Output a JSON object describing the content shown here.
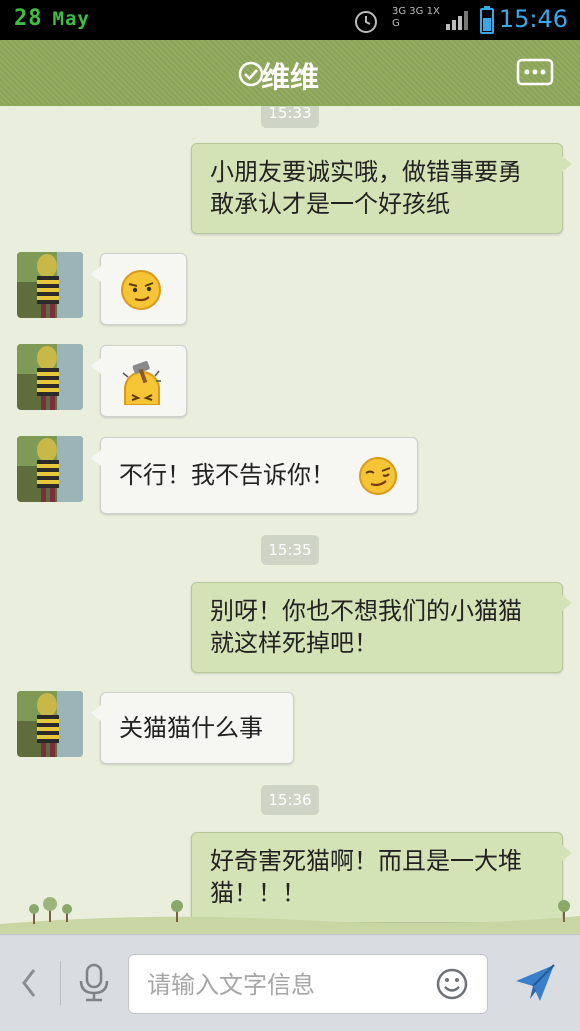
{
  "status_bar": {
    "day": "28",
    "month": "May",
    "network": "3G 3G 1X G",
    "time": "15:46"
  },
  "header": {
    "title": "维维"
  },
  "messages": {
    "top_timestamp": "15:33",
    "m1": "小朋友要诚实哦，做错事要勇敢承认才是一个好孩纸",
    "m2_emoji": "smirk-emoji",
    "m3_emoji": "hammer-head-emoji",
    "m4": "不行！我不告诉你！",
    "ts2": "15:35",
    "m5": "别呀！你也不想我们的小猫猫就这样死掉吧！",
    "m6": "关猫猫什么事",
    "ts3": "15:36",
    "m7": "好奇害死猫啊！而且是一大堆猫！！！"
  },
  "input_bar": {
    "placeholder": "请输入文字信息"
  },
  "colors": {
    "header": "#8ea85a",
    "right_bubble": "#d4e3b6",
    "left_bubble": "#f6f6f3",
    "clock": "#3aa7e6",
    "date": "#3fbf3f"
  }
}
